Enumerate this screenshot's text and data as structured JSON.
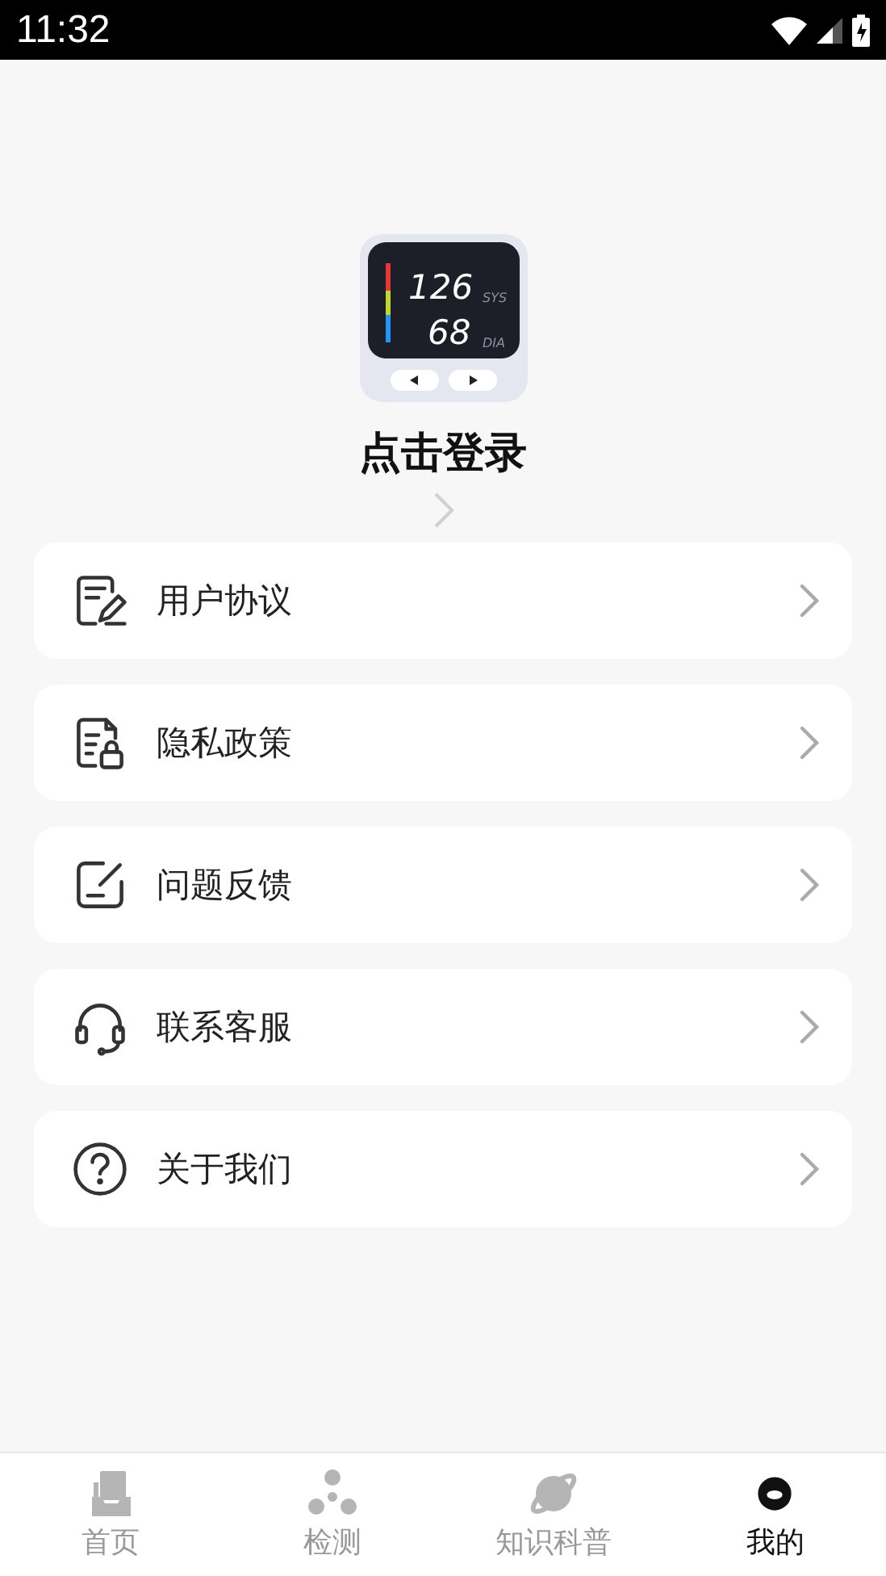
{
  "status_bar": {
    "time": "11:32"
  },
  "profile": {
    "logo_readings": [
      "126",
      "68"
    ],
    "logo_units": [
      "SYS",
      "DIA"
    ],
    "login_label": "点击登录"
  },
  "menu": [
    {
      "kind": "agreement",
      "label": "用户协议"
    },
    {
      "kind": "privacy",
      "label": "隐私政策"
    },
    {
      "kind": "feedback",
      "label": "问题反馈"
    },
    {
      "kind": "support",
      "label": "联系客服"
    },
    {
      "kind": "about",
      "label": "关于我们"
    }
  ],
  "tabs": [
    {
      "kind": "home",
      "label": "首页",
      "selected": false
    },
    {
      "kind": "detect",
      "label": "检测",
      "selected": false
    },
    {
      "kind": "knowledge",
      "label": "知识科普",
      "selected": false
    },
    {
      "kind": "me",
      "label": "我的",
      "selected": true
    }
  ]
}
